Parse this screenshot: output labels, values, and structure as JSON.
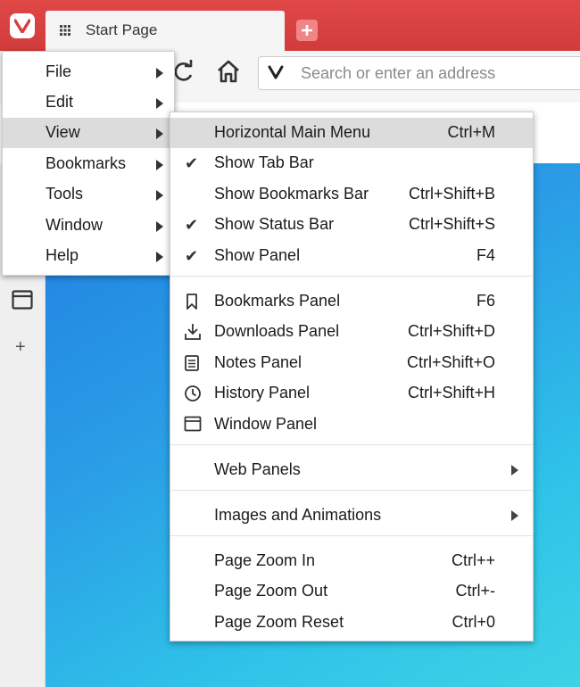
{
  "tab": {
    "title": "Start Page"
  },
  "address": {
    "placeholder": "Search or enter an address"
  },
  "icons": {
    "logo": "vivaldi-logo-icon",
    "tab": "grid-icon",
    "new_tab": "plus-icon",
    "reload": "reload-icon",
    "home": "home-icon",
    "window_panel": "window-icon",
    "add_panel": "plus-icon"
  },
  "colors": {
    "tabstrip": "#d93f3f",
    "content_gradient_start": "#1f7fe0",
    "content_gradient_end": "#3ed2e6",
    "menu_highlight": "#dcdcdc"
  },
  "main_menu": {
    "items": [
      {
        "label": "File",
        "accel": "F"
      },
      {
        "label": "Edit",
        "accel": "E"
      },
      {
        "label": "View",
        "accel": "V",
        "selected": true
      },
      {
        "label": "Bookmarks",
        "accel": "B"
      },
      {
        "label": "Tools",
        "accel": "T"
      },
      {
        "label": "Window",
        "accel": "W"
      },
      {
        "label": "Help",
        "accel": "H"
      }
    ]
  },
  "view_menu": {
    "items": [
      {
        "label": "Horizontal Main Menu",
        "shortcut": "Ctrl+M",
        "selected": true
      },
      {
        "label": "Show Tab Bar",
        "shortcut": "",
        "checked": true
      },
      {
        "label": "Show Bookmarks Bar",
        "shortcut": "Ctrl+Shift+B",
        "checked": false
      },
      {
        "label": "Show Status Bar",
        "shortcut": "Ctrl+Shift+S",
        "checked": true
      },
      {
        "label": "Show Panel",
        "shortcut": "F4",
        "checked": true
      },
      {
        "label": "Bookmarks Panel",
        "shortcut": "F6",
        "icon": "bookmark-icon"
      },
      {
        "label": "Downloads Panel",
        "shortcut": "Ctrl+Shift+D",
        "icon": "download-icon"
      },
      {
        "label": "Notes Panel",
        "shortcut": "Ctrl+Shift+O",
        "icon": "notes-icon"
      },
      {
        "label": "History Panel",
        "shortcut": "Ctrl+Shift+H",
        "icon": "history-icon"
      },
      {
        "label": "Window Panel",
        "shortcut": "",
        "icon": "window-icon"
      },
      {
        "label": "Web Panels",
        "submenu": true
      },
      {
        "label": "Images and Animations",
        "submenu": true
      },
      {
        "label": "Page Zoom In",
        "shortcut": "Ctrl++"
      },
      {
        "label": "Page Zoom Out",
        "shortcut": "Ctrl+-"
      },
      {
        "label": "Page Zoom Reset",
        "shortcut": "Ctrl+0"
      }
    ]
  }
}
